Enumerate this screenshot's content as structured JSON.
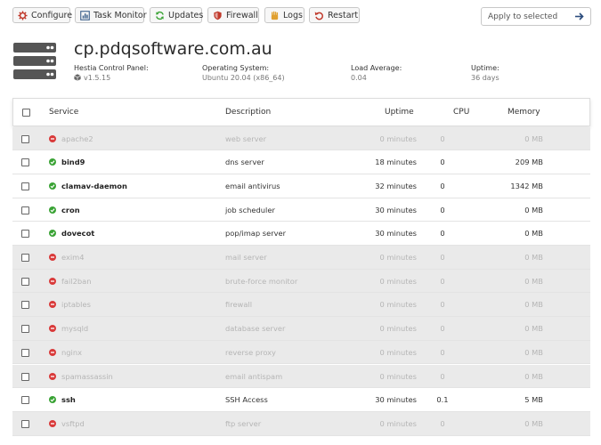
{
  "toolbar": {
    "buttons": [
      {
        "label": "Configure",
        "icon": "gear-icon",
        "color": "#c0392b"
      },
      {
        "label": "Task Monitor",
        "icon": "chart-icon",
        "color": "#3b5f8a"
      },
      {
        "label": "Updates",
        "icon": "refresh-icon",
        "color": "#3aa335"
      },
      {
        "label": "Firewall",
        "icon": "shield-icon",
        "color": "#c0392b"
      },
      {
        "label": "Logs",
        "icon": "hand-icon",
        "color": "#e0a030"
      },
      {
        "label": "Restart",
        "icon": "undo-icon",
        "color": "#c0392b"
      }
    ],
    "apply_placeholder": "Apply to selected"
  },
  "header": {
    "hostname": "cp.pdqsoftware.com.au",
    "panel_label": "Hestia Control Panel:",
    "panel_version": "v1.5.15",
    "os_label": "Operating System:",
    "os_value": "Ubuntu 20.04 (x86_64)",
    "load_label": "Load Average:",
    "load_value": "0.04",
    "uptime_label": "Uptime:",
    "uptime_value": "36 days"
  },
  "table": {
    "headers": {
      "service": "Service",
      "description": "Description",
      "uptime": "Uptime",
      "cpu": "CPU",
      "memory": "Memory"
    },
    "rows": [
      {
        "name": "apache2",
        "desc": "web server",
        "uptime": "0 minutes",
        "cpu": "0",
        "mem": "0 MB",
        "status": "stopped"
      },
      {
        "name": "bind9",
        "desc": "dns server",
        "uptime": "18 minutes",
        "cpu": "0",
        "mem": "209 MB",
        "status": "running"
      },
      {
        "name": "clamav-daemon",
        "desc": "email antivirus",
        "uptime": "32 minutes",
        "cpu": "0",
        "mem": "1342 MB",
        "status": "running"
      },
      {
        "name": "cron",
        "desc": "job scheduler",
        "uptime": "30 minutes",
        "cpu": "0",
        "mem": "0 MB",
        "status": "running"
      },
      {
        "name": "dovecot",
        "desc": "pop/imap server",
        "uptime": "30 minutes",
        "cpu": "0",
        "mem": "0 MB",
        "status": "running"
      },
      {
        "name": "exim4",
        "desc": "mail server",
        "uptime": "0 minutes",
        "cpu": "0",
        "mem": "0 MB",
        "status": "stopped"
      },
      {
        "name": "fail2ban",
        "desc": "brute-force monitor",
        "uptime": "0 minutes",
        "cpu": "0",
        "mem": "0 MB",
        "status": "stopped"
      },
      {
        "name": "iptables",
        "desc": "firewall",
        "uptime": "0 minutes",
        "cpu": "0",
        "mem": "0 MB",
        "status": "stopped"
      },
      {
        "name": "mysqld",
        "desc": "database server",
        "uptime": "0 minutes",
        "cpu": "0",
        "mem": "0 MB",
        "status": "stopped"
      },
      {
        "name": "nginx",
        "desc": "reverse proxy",
        "uptime": "0 minutes",
        "cpu": "0",
        "mem": "0 MB",
        "status": "stopped"
      },
      {
        "name": "spamassassin",
        "desc": "email antispam",
        "uptime": "0 minutes",
        "cpu": "0",
        "mem": "0 MB",
        "status": "stopped"
      },
      {
        "name": "ssh",
        "desc": "SSH Access",
        "uptime": "30 minutes",
        "cpu": "0.1",
        "mem": "5 MB",
        "status": "running"
      },
      {
        "name": "vsftpd",
        "desc": "ftp server",
        "uptime": "0 minutes",
        "cpu": "0",
        "mem": "0 MB",
        "status": "stopped"
      }
    ]
  },
  "colors": {
    "running": "#3aa335",
    "stopped": "#d93a3a",
    "stopped_row": "#eaeaea"
  }
}
